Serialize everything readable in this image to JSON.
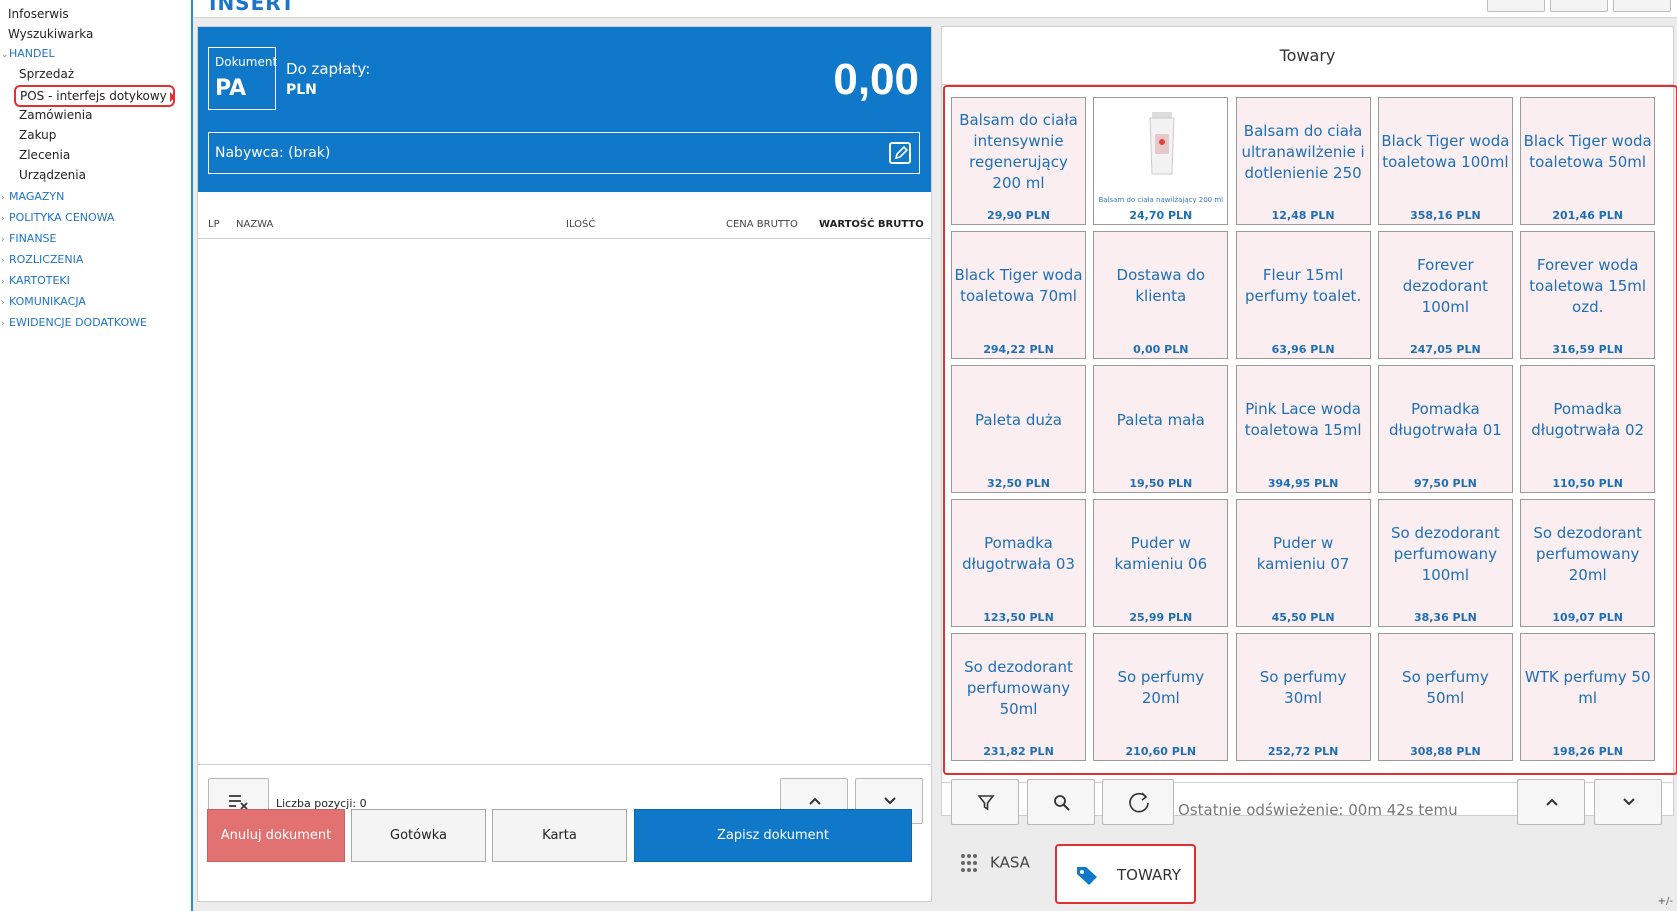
{
  "sidebar": {
    "top_items": [
      "Infoserwis",
      "Wyszukiwarka"
    ],
    "handel": "HANDEL",
    "handel_items": [
      "Sprzedaż",
      "POS - interfejs dotykowy",
      "Zamówienia",
      "Zakup",
      "Zlecenia",
      "Urządzenia"
    ],
    "categories": [
      "MAGAZYN",
      "POLITYKA CENOWA",
      "FINANSE",
      "ROZLICZENIA",
      "KARTOTEKI",
      "KOMUNIKACJA",
      "EWIDENCJE DODATKOWE"
    ]
  },
  "header": {
    "logo_fragment": "INSERT"
  },
  "document": {
    "badge_label": "Dokument",
    "badge_value": "PA",
    "pay_label": "Do zapłaty:",
    "currency": "PLN",
    "amount": "0,00",
    "buyer": "Nabywca: (brak)"
  },
  "columns": {
    "lp": "LP",
    "name": "NAZWA",
    "qty": "ILOŚĆ",
    "price": "CENA BRUTTO",
    "value": "WARTOŚĆ BRUTTO"
  },
  "positions_count": "Liczba pozycji: 0",
  "actions": {
    "cancel": "Anuluj dokument",
    "cash": "Gotówka",
    "card": "Karta",
    "save": "Zapisz dokument"
  },
  "products": {
    "title": "Towary",
    "refresh": "Ostatnie odświeżenie: 00m 42s temu",
    "image_caption": "Balsam do ciała nawilżający 200 ml",
    "items": [
      {
        "name": "Balsam do ciała intensywnie regenerujący 200 ml",
        "price": "29,90 PLN"
      },
      {
        "name": "",
        "price": "24,70 PLN"
      },
      {
        "name": "Balsam do ciała ultranawilżenie i dotlenienie 250",
        "price": "12,48 PLN"
      },
      {
        "name": "Black Tiger woda toaletowa 100ml",
        "price": "358,16 PLN"
      },
      {
        "name": "Black Tiger woda toaletowa 50ml",
        "price": "201,46 PLN"
      },
      {
        "name": "Black Tiger woda toaletowa 70ml",
        "price": "294,22 PLN"
      },
      {
        "name": "Dostawa do klienta",
        "price": "0,00 PLN"
      },
      {
        "name": "Fleur 15ml perfumy toalet.",
        "price": "63,96 PLN"
      },
      {
        "name": "Forever dezodorant 100ml",
        "price": "247,05 PLN"
      },
      {
        "name": "Forever woda toaletowa 15ml ozd.",
        "price": "316,59 PLN"
      },
      {
        "name": "Paleta duża",
        "price": "32,50 PLN"
      },
      {
        "name": "Paleta mała",
        "price": "19,50 PLN"
      },
      {
        "name": "Pink Lace woda toaletowa 15ml",
        "price": "394,95 PLN"
      },
      {
        "name": "Pomadka długotrwała 01",
        "price": "97,50 PLN"
      },
      {
        "name": "Pomadka długotrwała 02",
        "price": "110,50 PLN"
      },
      {
        "name": "Pomadka długotrwała 03",
        "price": "123,50 PLN"
      },
      {
        "name": "Puder w kamieniu 06",
        "price": "25,99 PLN"
      },
      {
        "name": "Puder w kamieniu 07",
        "price": "45,50 PLN"
      },
      {
        "name": "So dezodorant perfumowany 100ml",
        "price": "38,36 PLN"
      },
      {
        "name": "So dezodorant perfumowany 20ml",
        "price": "109,07 PLN"
      },
      {
        "name": "So dezodorant perfumowany 50ml",
        "price": "231,82 PLN"
      },
      {
        "name": "So perfumy 20ml",
        "price": "210,60 PLN"
      },
      {
        "name": "So perfumy 30ml",
        "price": "252,72 PLN"
      },
      {
        "name": "So perfumy 50ml",
        "price": "308,88 PLN"
      },
      {
        "name": "WTK perfumy 50 ml",
        "price": "198,26 PLN"
      }
    ]
  },
  "tabs": {
    "kasa": "KASA",
    "towary": "TOWARY"
  },
  "corner": "+/-",
  "colors": {
    "primary": "#0f78c8",
    "cancel": "#e27171",
    "highlight": "#e03030",
    "tile_bg": "#fbeef0"
  }
}
